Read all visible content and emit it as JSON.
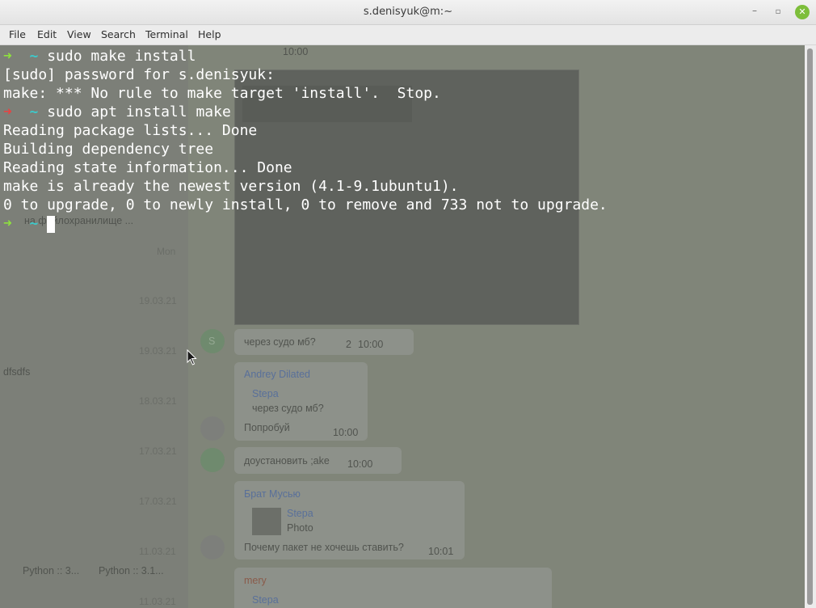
{
  "window": {
    "title": "s.denisyuk@m:~",
    "minimize_icon": "–",
    "maximize_icon": "▫",
    "close_icon": "✕"
  },
  "menu": {
    "items": [
      "File",
      "Edit",
      "View",
      "Search",
      "Terminal",
      "Help"
    ]
  },
  "terminal": {
    "prompt_arrow": "➜",
    "prompt_dir": "~",
    "lines": [
      {
        "cmd": "sudo make install"
      },
      {
        "text": "[sudo] password for s.denisyuk:"
      },
      {
        "text": "make: *** No rule to make target 'install'.  Stop."
      },
      {
        "cmd": "sudo apt install make"
      },
      {
        "text": "Reading package lists... Done"
      },
      {
        "text": "Building dependency tree"
      },
      {
        "text": "Reading state information... Done"
      },
      {
        "text": "make is already the newest version (4.1-9.1ubuntu1)."
      },
      {
        "text": "0 to upgrade, 0 to newly install, 0 to remove and 733 not to upgrade."
      }
    ]
  },
  "background_chat": {
    "dates": [
      "Mon",
      "19.03.21",
      "19.03.21",
      "18.03.21",
      "17.03.21",
      "17.03.21",
      "11.03.21",
      "11.03.21"
    ],
    "left_snippets": [
      "на файлохранилище ...",
      "dfsdfs",
      "Python :: 3...",
      "Python :: 3.1..."
    ],
    "messages": [
      {
        "name": "",
        "text": "через судо мб?",
        "time": "10:00"
      },
      {
        "name": "Andrey Dilated",
        "reply_name": "Stepa",
        "reply_text": "через судо мб?",
        "text": "Попробуй",
        "time": "10:00"
      },
      {
        "name": "",
        "text": "доустановить ;ake",
        "time": "10:00"
      },
      {
        "name": "Брат Мусью",
        "reply_name": "Stepa",
        "reply_text": "Photo",
        "text": "Почему пакет не хочешь ставить?",
        "time": "10:01"
      },
      {
        "name": "mery",
        "reply_name": "Stepa",
        "reply_text": "",
        "text": "",
        "time": ""
      }
    ],
    "top_time": "10:00",
    "avatar_letter": "S",
    "reply_count": "2"
  },
  "colors": {
    "prompt_ok": "#8ee03f",
    "prompt_err": "#e34545",
    "tilde": "#3fc7c8",
    "close_button": "#7dbe3a"
  }
}
